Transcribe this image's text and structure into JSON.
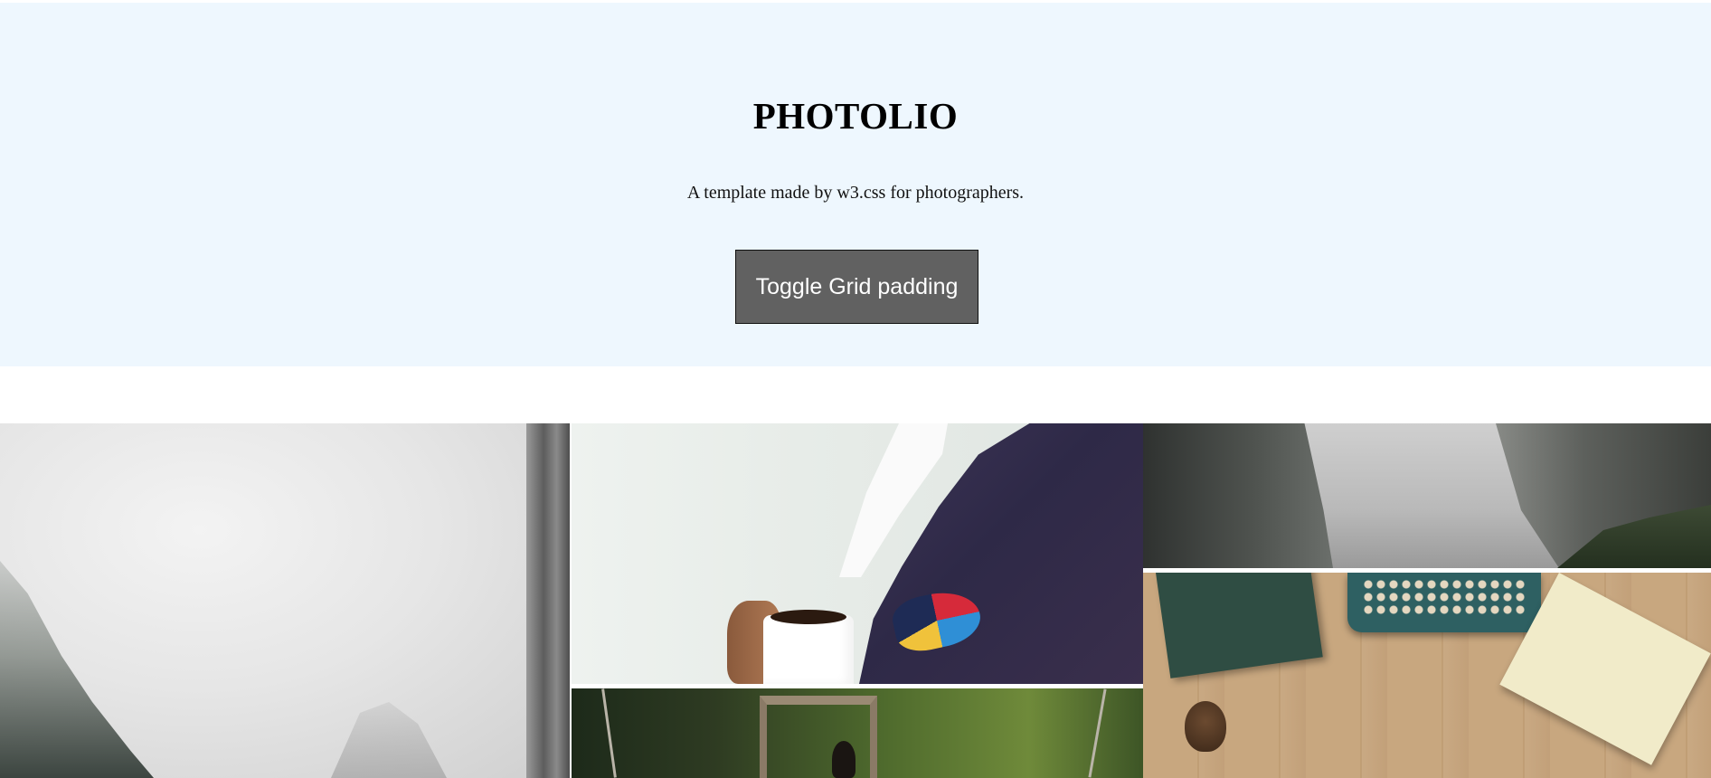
{
  "header": {
    "title": "PHOTOLIO",
    "subtitle": "A template made by w3.css for photographers.",
    "toggle_button_label": "Toggle Grid padding",
    "background_color": "#eef7fe",
    "button_color": "#616161"
  },
  "gallery": {
    "photos": [
      {
        "subject": "misty cliffs"
      },
      {
        "subject": "man in suit holding coffee cup"
      },
      {
        "subject": "misty canyon"
      },
      {
        "subject": "typewriter, book and notebook on wooden desk"
      },
      {
        "subject": "forest suspension bridge"
      }
    ]
  }
}
